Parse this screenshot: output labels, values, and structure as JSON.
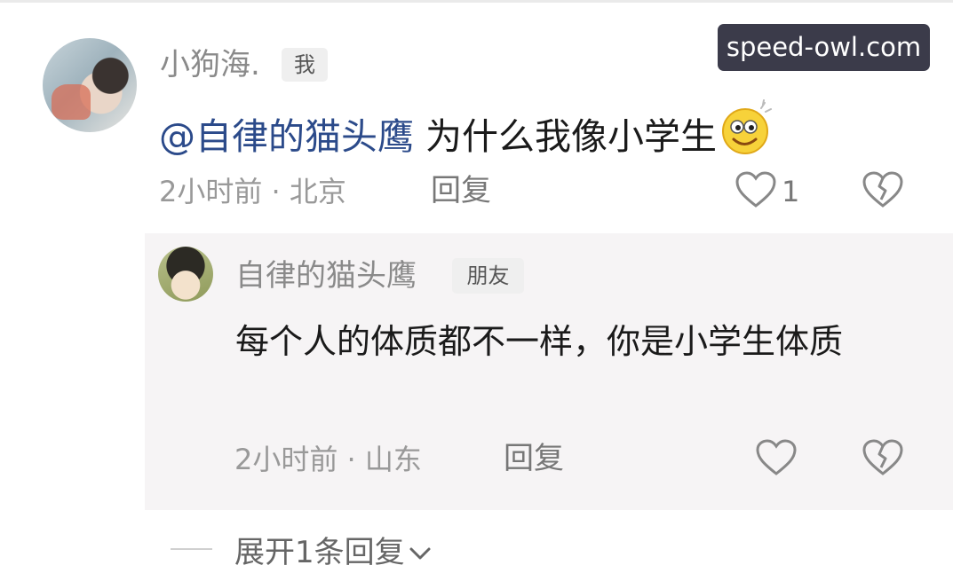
{
  "watermark": "speed-owl.com",
  "comment": {
    "username": "小狗海.",
    "badge": "我",
    "mention": "@自律的猫头鹰",
    "text": " 为什么我像小学生",
    "meta": "2小时前 · 北京",
    "reply_label": "回复",
    "like_count": "1",
    "emoji": "smiling-face-icon"
  },
  "reply": {
    "username": "自律的猫头鹰",
    "badge": "朋友",
    "text": "每个人的体质都不一样，你是小学生体质",
    "meta": "2小时前 · 山东",
    "reply_label": "回复"
  },
  "expand_label": "展开1条回复",
  "colors": {
    "mention": "#2b4a8a",
    "watermark_bg": "#3b3b4a",
    "reply_bg": "#f6f4f5"
  }
}
